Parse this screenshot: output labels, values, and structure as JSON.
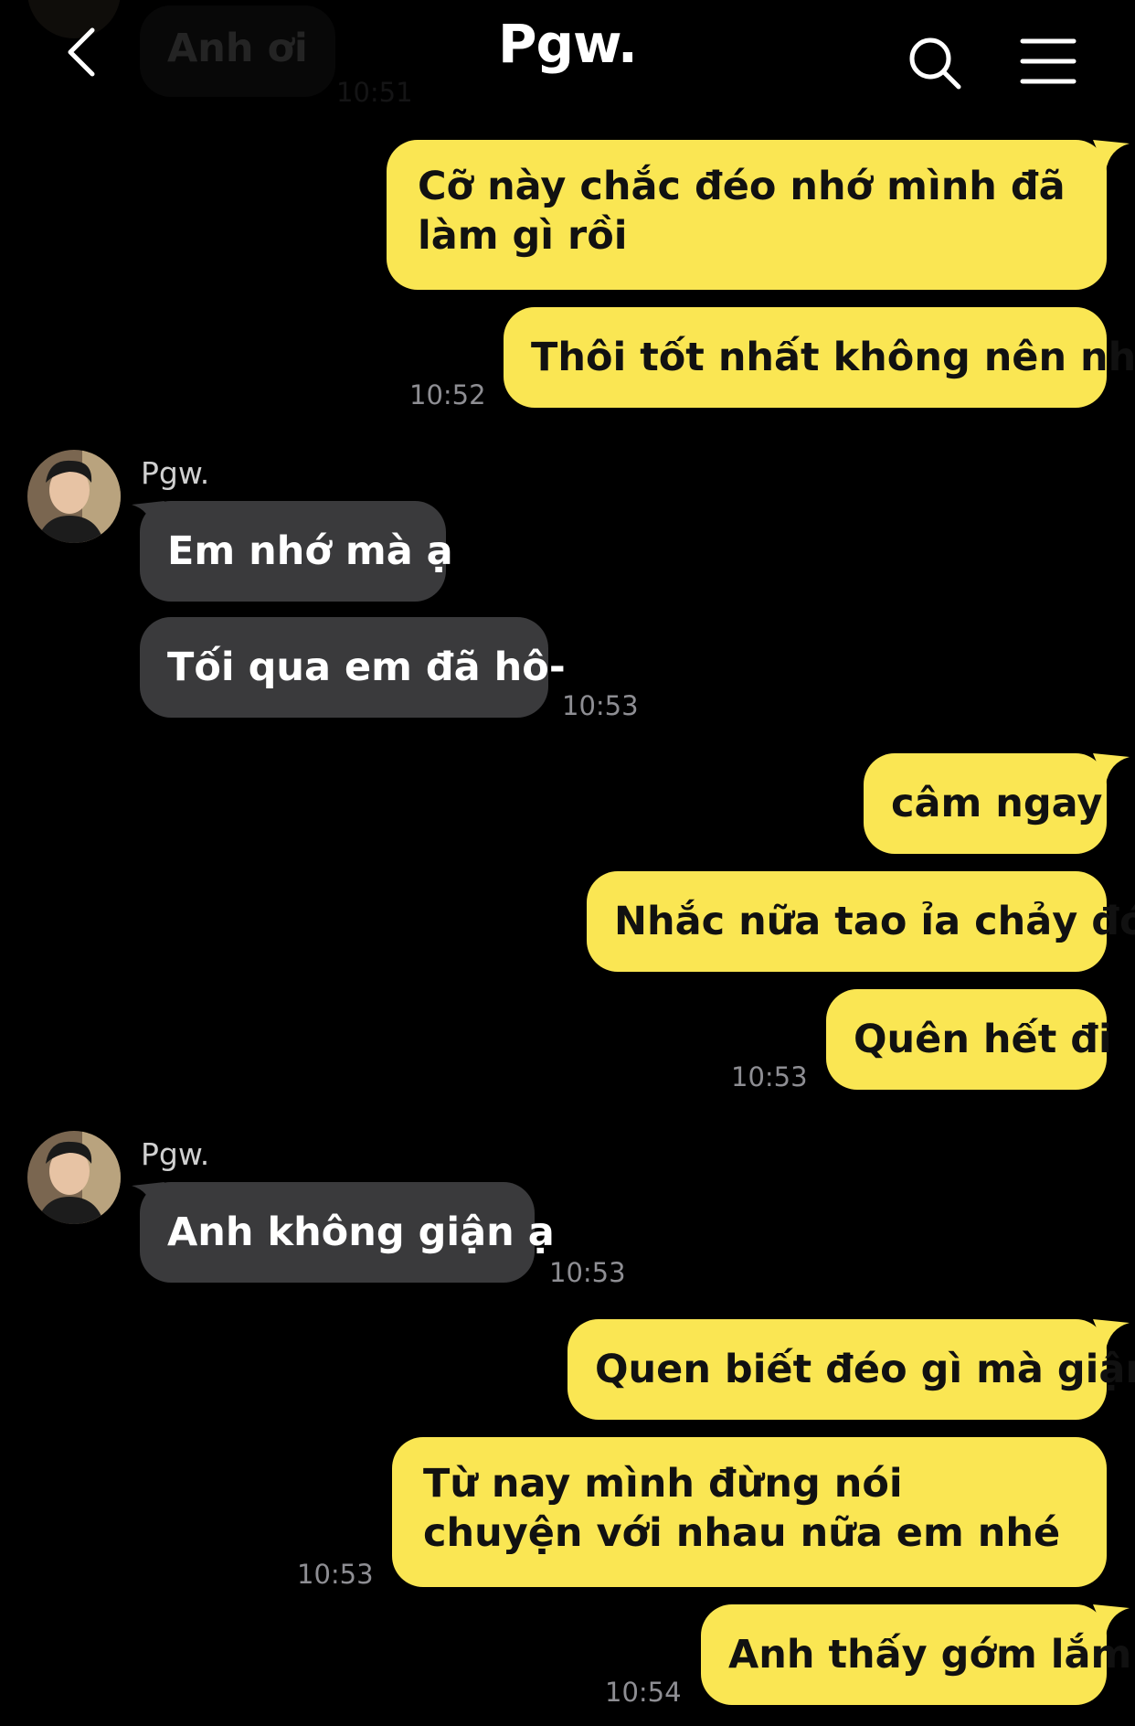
{
  "header": {
    "title": "Pgw.",
    "back_icon": "chevron-left-icon",
    "search_icon": "search-icon",
    "menu_icon": "hamburger-menu-icon"
  },
  "colors": {
    "background": "#000000",
    "outgoing_bubble": "#fae653",
    "incoming_bubble": "#3a3a3c",
    "timestamp": "#8e8e93"
  },
  "messages": {
    "m0": {
      "text": "Anh ơi",
      "time": "10:51"
    },
    "m1": {
      "text": "Cỡ này chắc đéo nhớ mình đã làm gì rồi"
    },
    "m2": {
      "text": "Thôi tốt nhất không nên nhớ",
      "time": "10:52"
    },
    "g1_sender": "Pgw.",
    "m3": {
      "text": "Em nhớ mà ạ"
    },
    "m4": {
      "text": "Tối qua em đã hô-",
      "time": "10:53"
    },
    "m5": {
      "text": "câm ngay"
    },
    "m6": {
      "text": "Nhắc nữa tao ỉa chảy đó"
    },
    "m7": {
      "text": "Quên hết đi",
      "time": "10:53"
    },
    "g2_sender": "Pgw.",
    "m8": {
      "text": "Anh không giận ạ",
      "time": "10:53"
    },
    "m9": {
      "text": "Quen biết đéo gì mà giận"
    },
    "m10": {
      "text": "Từ nay mình  đừng nói chuyện với nhau nữa em nhé",
      "time": "10:53"
    },
    "m11": {
      "text": "Anh thấy gớm lắm",
      "time": "10:54"
    }
  }
}
